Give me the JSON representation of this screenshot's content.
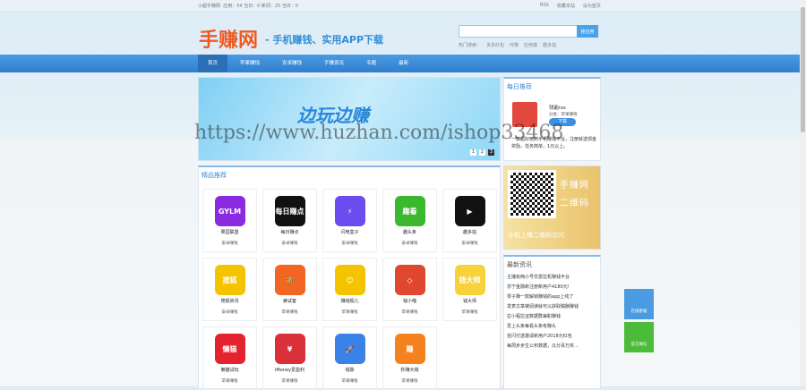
{
  "topbar": {
    "site": "小超手赚网",
    "stats": "应用：54 当日：0 新闻：25 当日：0",
    "links": [
      "RSS",
      "收藏本站",
      "设为首页"
    ]
  },
  "header": {
    "logo": "手赚网",
    "slogan": "- 手机赚钱、实用APP下载",
    "search_button": "搜应用",
    "search_placeholder": "",
    "hot_label": "热门搜索：",
    "hot": [
      "多多红包",
      "咔赚",
      "应用猿",
      "趣多拍"
    ]
  },
  "nav": [
    "首页",
    "苹果赚钱",
    "安卓赚钱",
    "手赚资讯",
    "专题",
    "最新"
  ],
  "banner": {
    "title": "边玩边赚",
    "dots": [
      "1",
      "2",
      "3"
    ]
  },
  "featured": {
    "title": "精品推荐",
    "apps": [
      {
        "name": "果园联盟",
        "cat": "安卓赚钱",
        "color": "#8a2be2",
        "glyph": "GYLM"
      },
      {
        "name": "每日赚点",
        "cat": "安卓赚钱",
        "color": "#111111",
        "glyph": "每日赚点"
      },
      {
        "name": "闪电盒子",
        "cat": "安卓赚钱",
        "color": "#6a4cf0",
        "glyph": "⚡"
      },
      {
        "name": "趣头条",
        "cat": "安卓赚钱",
        "color": "#3cb82e",
        "glyph": "趣看"
      },
      {
        "name": "趣多拍",
        "cat": "安卓赚钱",
        "color": "#111111",
        "glyph": "▶"
      },
      {
        "name": "搜狐资讯",
        "cat": "安卓赚钱",
        "color": "#f5c400",
        "glyph": "搜狐"
      },
      {
        "name": "蜂试客",
        "cat": "苹果赚钱",
        "color": "#f26522",
        "glyph": "🐝"
      },
      {
        "name": "赚钱狐儿",
        "cat": "苹果赚钱",
        "color": "#f5c400",
        "glyph": "☺"
      },
      {
        "name": "钱小喵",
        "cat": "苹果赚钱",
        "color": "#e0472f",
        "glyph": "◇"
      },
      {
        "name": "钱大师",
        "cat": "苹果赚钱",
        "color": "#f7d23a",
        "glyph": "钱大师"
      },
      {
        "name": "懒猫试玩",
        "cat": "苹果赚钱",
        "color": "#e4232f",
        "glyph": "懒猫"
      },
      {
        "name": "iMoney爱盈利",
        "cat": "苹果赚钱",
        "color": "#d9303a",
        "glyph": "¥"
      },
      {
        "name": "钱脉",
        "cat": "苹果赚钱",
        "color": "#3b82e8",
        "glyph": "🚀"
      },
      {
        "name": "秒赚大钱",
        "cat": "苹果赚钱",
        "color": "#f5811f",
        "glyph": "赚"
      }
    ]
  },
  "daily": {
    "title": "每日推荐",
    "app_name": "钱能ios",
    "category": "分类：苹果赚钱",
    "download": "下载",
    "desc": "一款超好玩的手机赚钱平台，注册就送现金奖励，任务简单，1元以上。"
  },
  "qr": {
    "line1": "手赚网",
    "line2": "二维码",
    "caption": "手机上赚二维码访问"
  },
  "news": {
    "title": "最新资讯",
    "items": [
      "主播有两小号优雷拉机赚钱平台",
      "苏宁金融新注册新用户4180元!",
      "零子赚一款解锁赚钱的app上线了",
      "发表文章被阅读就可以获取稿酬赚钱",
      "拉小程拉证数据群兼职赚钱",
      "爱上头条每看头条有赚头",
      "芸闪付送邀请新用户2018元红包",
      "每周步步生公布数据，瓜分百万奖..."
    ]
  },
  "float": [
    "在线客服",
    "官方微信"
  ],
  "watermark": "https://www.huzhan.com/ishop33468"
}
